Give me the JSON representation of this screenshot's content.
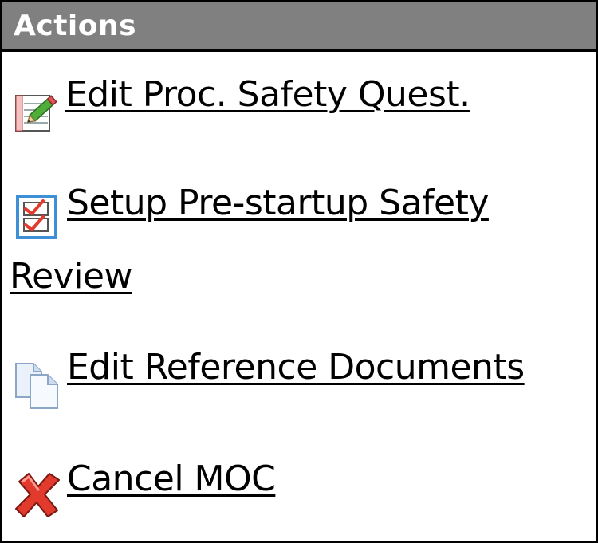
{
  "panel": {
    "title": "Actions"
  },
  "actions": [
    {
      "label": "Edit Proc. Safety Quest.",
      "icon": "notepad-pencil-icon"
    },
    {
      "label_line1": "Setup Pre-startup Safety",
      "label_line2": "Review",
      "icon": "checklist-icon"
    },
    {
      "label": "Edit Reference Documents",
      "icon": "documents-icon"
    },
    {
      "label": "Cancel MOC",
      "icon": "red-x-icon"
    }
  ],
  "colors": {
    "header_bg": "#808080",
    "header_text": "#ffffff",
    "border": "#000000",
    "link": "#000000",
    "cancel_red": "#e23b2e",
    "checkbox_blue": "#3d8fd6"
  }
}
